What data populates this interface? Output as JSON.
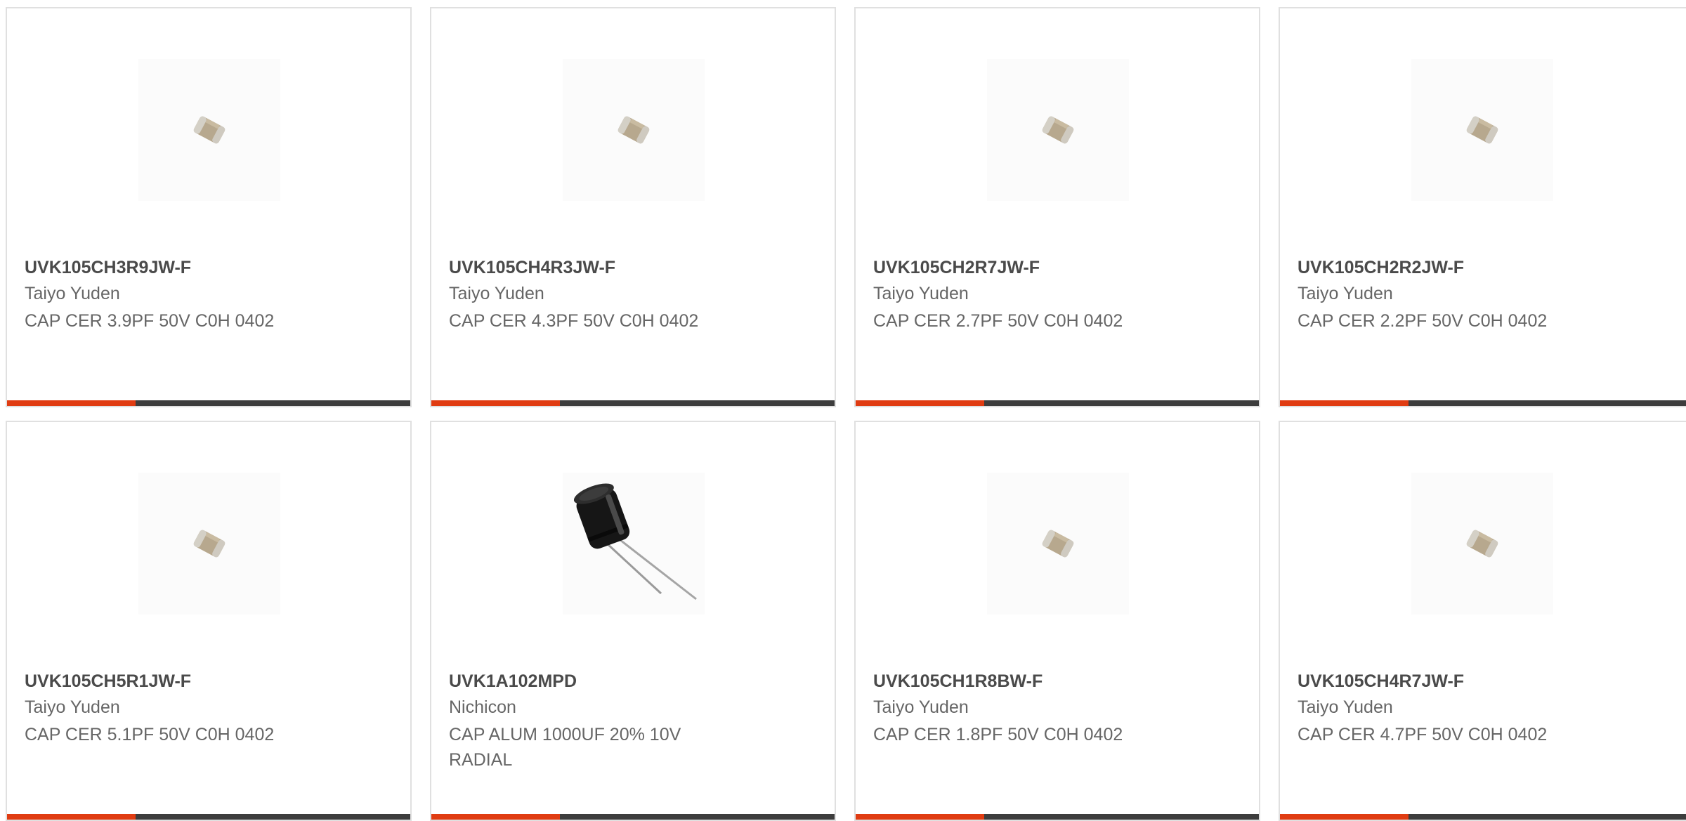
{
  "colors": {
    "accent": "#e03c12",
    "bar": "#3d3d3d",
    "card_border": "#e0e0e0",
    "part_text": "#4a4a4a",
    "body_text": "#666666"
  },
  "products": [
    {
      "part_number": "UVK105CH3R9JW-F",
      "manufacturer": "Taiyo Yuden",
      "description": "CAP CER 3.9PF 50V C0H 0402",
      "image": "ceramic-chip-capacitor-icon"
    },
    {
      "part_number": "UVK105CH4R3JW-F",
      "manufacturer": "Taiyo Yuden",
      "description": "CAP CER 4.3PF 50V C0H 0402",
      "image": "ceramic-chip-capacitor-icon"
    },
    {
      "part_number": "UVK105CH2R7JW-F",
      "manufacturer": "Taiyo Yuden",
      "description": "CAP CER 2.7PF 50V C0H 0402",
      "image": "ceramic-chip-capacitor-icon"
    },
    {
      "part_number": "UVK105CH2R2JW-F",
      "manufacturer": "Taiyo Yuden",
      "description": "CAP CER 2.2PF 50V C0H 0402",
      "image": "ceramic-chip-capacitor-icon"
    },
    {
      "part_number": "UVK105CH5R1JW-F",
      "manufacturer": "Taiyo Yuden",
      "description": "CAP CER 5.1PF 50V C0H 0402",
      "image": "ceramic-chip-capacitor-icon"
    },
    {
      "part_number": "UVK1A102MPD",
      "manufacturer": "Nichicon",
      "description": "CAP ALUM 1000UF 20% 10V RADIAL",
      "image": "electrolytic-capacitor-icon"
    },
    {
      "part_number": "UVK105CH1R8BW-F",
      "manufacturer": "Taiyo Yuden",
      "description": "CAP CER 1.8PF 50V C0H 0402",
      "image": "ceramic-chip-capacitor-icon"
    },
    {
      "part_number": "UVK105CH4R7JW-F",
      "manufacturer": "Taiyo Yuden",
      "description": "CAP CER 4.7PF 50V C0H 0402",
      "image": "ceramic-chip-capacitor-icon"
    }
  ]
}
